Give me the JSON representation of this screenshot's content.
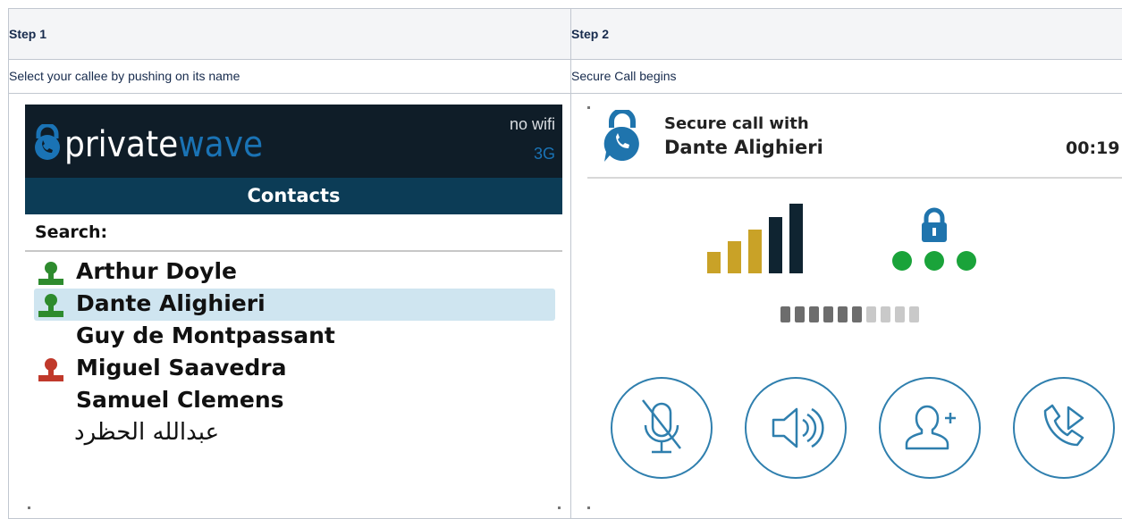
{
  "table": {
    "col1": {
      "header": "Step 1",
      "description": "Select your callee by pushing on its name"
    },
    "col2": {
      "header": "Step 2",
      "description": "Secure Call begins"
    }
  },
  "phone1": {
    "logo_part1": "private",
    "logo_part2": "wave",
    "network_line1": "no wifi",
    "network_line2": "3G",
    "screen_title": "Contacts",
    "search_label": "Search:",
    "contacts": [
      {
        "name": "Arthur Doyle",
        "status": "online",
        "status_color": "#2e8b2e",
        "selected": false
      },
      {
        "name": "Dante Alighieri",
        "status": "online",
        "status_color": "#2e8b2e",
        "selected": true
      },
      {
        "name": "Guy de Montpassant",
        "status": "none",
        "selected": false
      },
      {
        "name": "Miguel Saavedra",
        "status": "busy",
        "status_color": "#c0392b",
        "selected": false
      },
      {
        "name": "Samuel Clemens",
        "status": "none",
        "selected": false
      },
      {
        "name": "عبدالله الحظرد",
        "status": "none",
        "selected": false
      }
    ],
    "colors": {
      "topbar": "#0f1d28",
      "title_bar": "#0c3c56",
      "brand_blue": "#1a73b5",
      "selection": "#cfe5f0"
    }
  },
  "phone2": {
    "call_line1": "Secure call with",
    "call_line2": "Dante Alighieri",
    "timer": "00:19",
    "signal_bars_total": 5,
    "signal_bars_active": 5,
    "security_dots": 3,
    "audio_level_filled": 6,
    "audio_level_total": 10,
    "buttons": [
      {
        "name": "mute-button",
        "icon": "mic-muted-icon"
      },
      {
        "name": "speaker-button",
        "icon": "speaker-icon"
      },
      {
        "name": "add-participant-button",
        "icon": "add-user-icon"
      },
      {
        "name": "transfer-call-button",
        "icon": "phone-forward-icon"
      }
    ],
    "colors": {
      "accent_blue": "#2f7fae",
      "signal_gold": "#c9a227",
      "signal_dark": "#0f2431",
      "secure_green": "#1aa33a"
    }
  }
}
